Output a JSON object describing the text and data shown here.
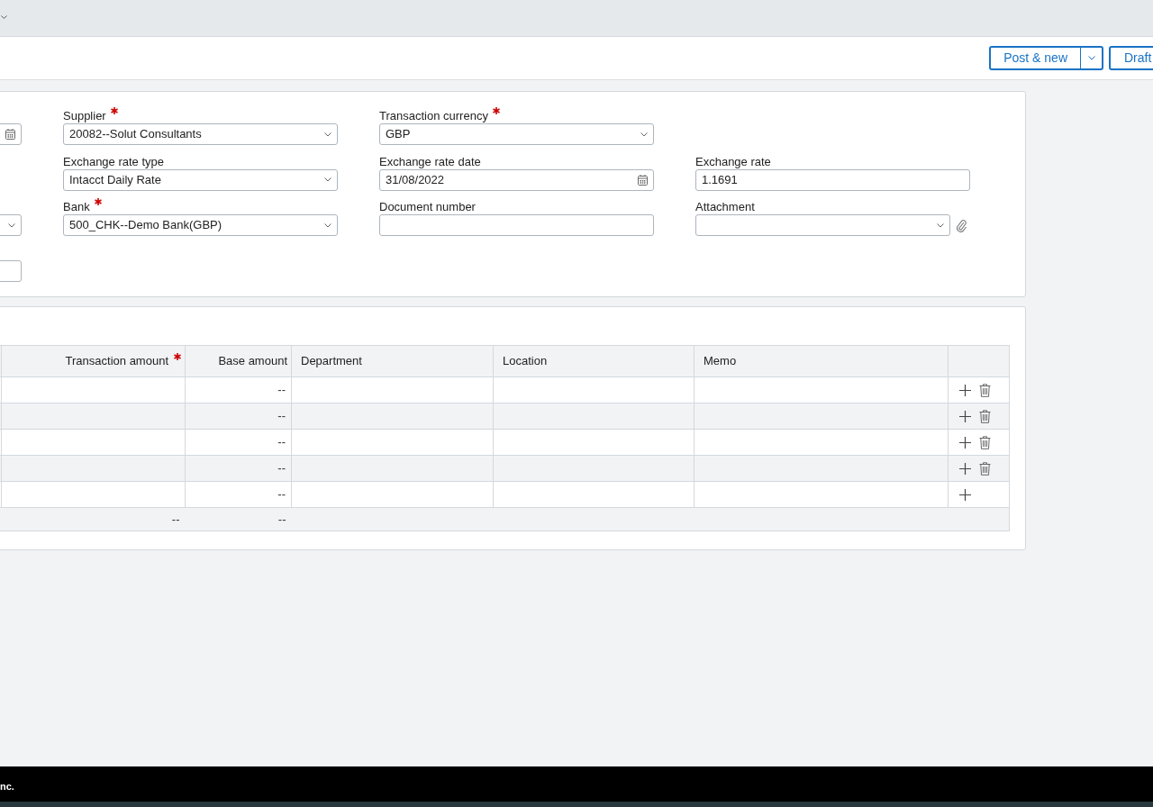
{
  "toolbar": {
    "buttons": [
      {
        "label": "Post & new",
        "kind": "split"
      },
      {
        "label": "Draft",
        "kind": "plain"
      }
    ]
  },
  "form": {
    "columns": [
      [
        {
          "kind": "date"
        },
        {
          "kind": "spacer"
        },
        {
          "kind": "select"
        },
        {
          "kind": "text"
        }
      ],
      [
        {
          "kind": "select",
          "label": "Supplier",
          "required": true,
          "value": "20082--Solut Consultants"
        },
        {
          "kind": "select",
          "label": "Exchange rate type",
          "required": false,
          "value": "Intacct Daily Rate"
        },
        {
          "kind": "select",
          "label": "Bank",
          "required": true,
          "value": "500_CHK--Demo Bank(GBP)"
        }
      ],
      [
        {
          "kind": "select",
          "label": "Transaction currency",
          "required": true,
          "value": "GBP"
        },
        {
          "kind": "date",
          "label": "Exchange rate date",
          "required": false,
          "value": "31/08/2022"
        },
        {
          "kind": "text",
          "label": "Document number",
          "required": false
        }
      ],
      [
        {
          "kind": "spacer"
        },
        {
          "kind": "text",
          "label": "Exchange rate",
          "required": false,
          "value": "1.1691"
        },
        {
          "kind": "attachment",
          "label": "Attachment",
          "required": false
        }
      ]
    ]
  },
  "table": {
    "columns": [
      {
        "label": "Transaction amount",
        "required": true,
        "kind": "amount"
      },
      {
        "label": "Base amount",
        "required": false,
        "kind": "amount"
      },
      {
        "label": "Department",
        "required": false,
        "kind": "text"
      },
      {
        "label": "Location",
        "required": false,
        "kind": "text"
      },
      {
        "label": "Memo",
        "required": false,
        "kind": "text"
      }
    ],
    "rows": [
      {
        "base_amount": "--",
        "deletable": true
      },
      {
        "base_amount": "--",
        "deletable": true
      },
      {
        "base_amount": "--",
        "deletable": true
      },
      {
        "base_amount": "--",
        "deletable": true
      },
      {
        "base_amount": "--",
        "deletable": false
      }
    ],
    "totals": [
      "--",
      "--"
    ]
  },
  "footer": {
    "text": "nc."
  }
}
